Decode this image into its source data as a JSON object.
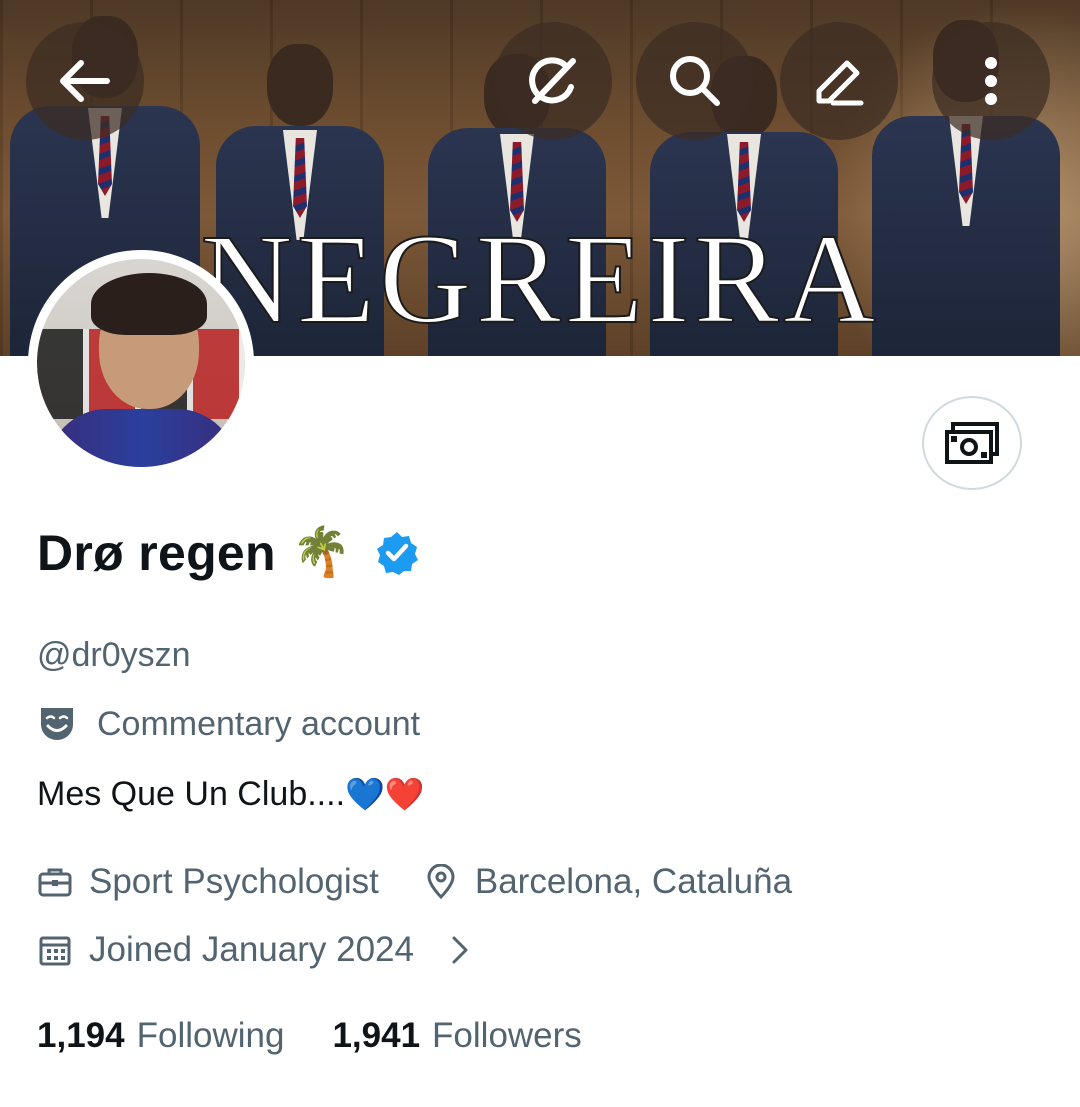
{
  "header": {
    "banner_text": "NEGREIRA",
    "back_icon": "arrow-left-icon",
    "grok_icon": "grok-icon",
    "search_icon": "search-icon",
    "edit_icon": "pencil-icon",
    "more_icon": "more-vertical-icon"
  },
  "tip_button": {
    "icon": "money-icon"
  },
  "profile": {
    "display_name": "Drø regen",
    "name_emoji": "🌴",
    "verified": true,
    "handle": "@dr0yszn",
    "category_icon": "theater-masks-icon",
    "category": "Commentary account",
    "bio_text": "Mes Que Un Club....",
    "bio_emojis": "💙❤️",
    "profession": "Sport Psychologist",
    "location": "Barcelona, Cataluña",
    "joined": "Joined January 2024"
  },
  "stats": {
    "following_count": "1,194",
    "following_label": "Following",
    "followers_count": "1,941",
    "followers_label": "Followers"
  },
  "colors": {
    "text_primary": "#0f1419",
    "text_secondary": "#536471",
    "verified_blue": "#1d9bf0",
    "border": "#cfd9de"
  }
}
